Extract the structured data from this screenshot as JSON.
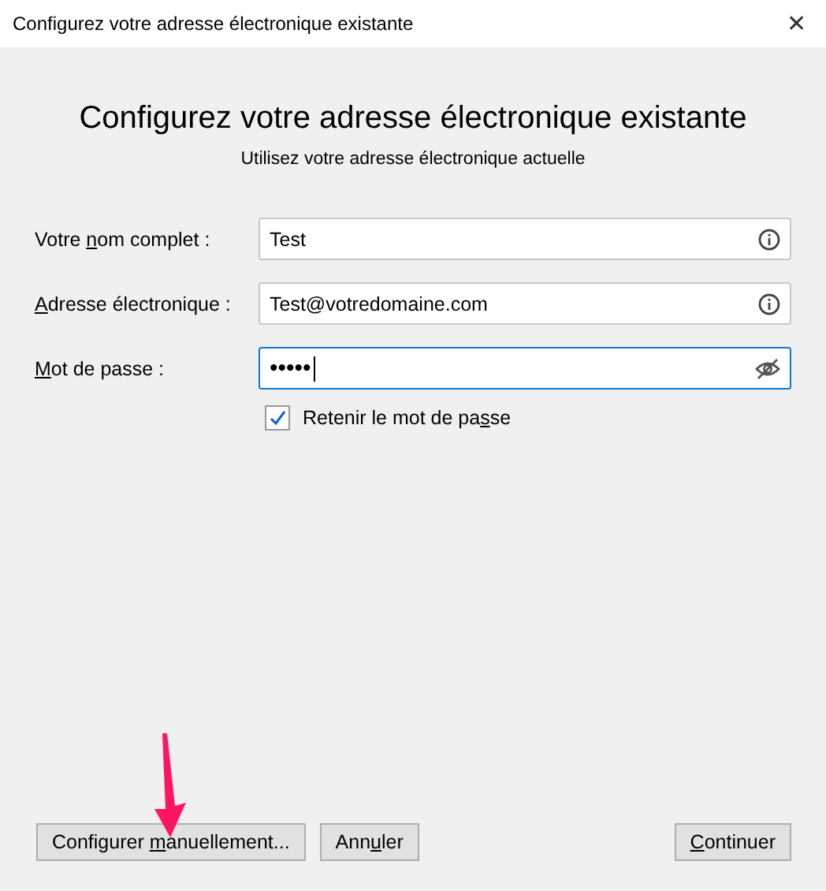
{
  "window": {
    "title": "Configurez votre adresse électronique existante",
    "close": "✕"
  },
  "heading": "Configurez votre adresse électronique existante",
  "subheading": "Utilisez votre adresse électronique actuelle",
  "fields": [
    {
      "kind": "text",
      "label": {
        "before": "Votre ",
        "key": "n",
        "after": "om complet :"
      },
      "value": "Test",
      "focused": false
    },
    {
      "kind": "text",
      "label": {
        "key": "A",
        "after": "dresse électronique :"
      },
      "value": "Test@votredomaine.com",
      "focused": false
    },
    {
      "kind": "password",
      "label": {
        "key": "M",
        "after": "ot de passe :"
      },
      "value": "•••••",
      "focused": true
    }
  ],
  "remember": {
    "label": {
      "before": "Retenir le mot de pa",
      "key": "s",
      "after": "se"
    },
    "checked": true
  },
  "buttons": [
    {
      "label": {
        "before": "Configurer ",
        "key": "m",
        "after": "anuellement..."
      }
    },
    {
      "label": {
        "before": "Ann",
        "key": "u",
        "after": "ler"
      }
    },
    {
      "label": {
        "key": "C",
        "after": "ontinuer"
      }
    }
  ],
  "annotation_arrow": true
}
